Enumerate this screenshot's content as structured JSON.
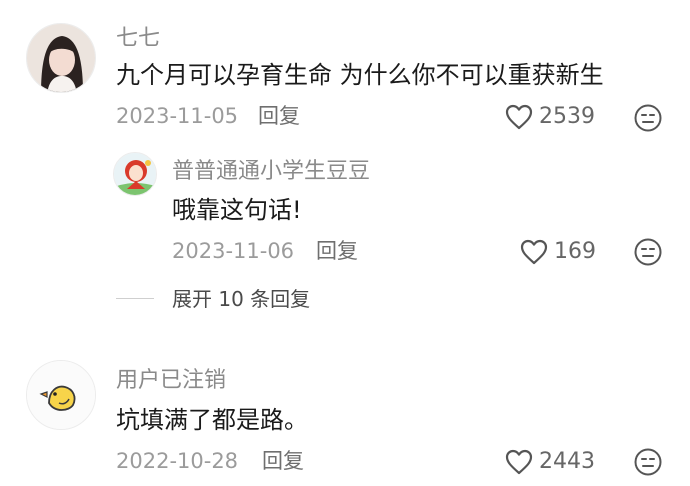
{
  "comments": [
    {
      "username": "七七",
      "text": "九个月可以孕育生命 为什么你不可以重获新生",
      "date": "2023-11-05",
      "reply_label": "回复",
      "likes": "2539",
      "avatar_icon": "girl-portrait-avatar"
    },
    {
      "username": "普普通通小学生豆豆",
      "text": "哦靠这句话!",
      "date": "2023-11-06",
      "reply_label": "回复",
      "likes": "169",
      "avatar_icon": "cartoon-girl-avatar"
    },
    {
      "username": "用户已注销",
      "text": "坑填满了都是路。",
      "date": "2022-10-28",
      "reply_label": "回复",
      "likes": "2443",
      "avatar_icon": "yellow-chick-avatar"
    }
  ],
  "expand_replies": {
    "label": "展开 10 条回复"
  },
  "icons": {
    "like": "heart-outline-icon",
    "emoji": "emoji-face-icon"
  },
  "colors": {
    "background": "#ffffff",
    "text_primary": "#1a1a1a",
    "text_secondary": "#8a8a8a",
    "icon": "#555555"
  }
}
